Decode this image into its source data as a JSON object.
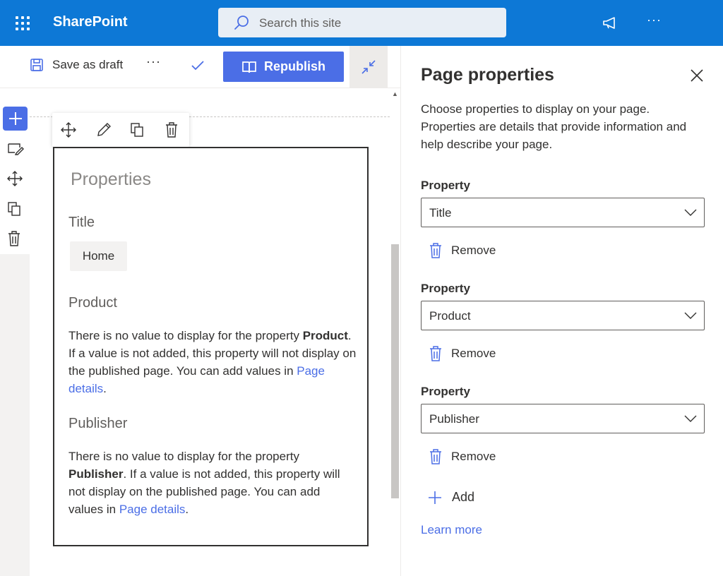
{
  "suite": {
    "brand": "SharePoint",
    "search_placeholder": "Search this site",
    "more": "···"
  },
  "command_bar": {
    "save_draft": "Save as draft",
    "more": "···",
    "republish": "Republish"
  },
  "webpart": {
    "title": "Properties",
    "fields": [
      {
        "label": "Title",
        "value": "Home"
      },
      {
        "label": "Product",
        "msg_prefix": "There is no value to display for the property ",
        "msg_bold": "Product",
        "msg_suffix": ". If a value is not added, this property will not display on the published page. You can add values in ",
        "link": "Page details",
        "msg_end": "."
      },
      {
        "label": "Publisher",
        "msg_prefix": "There is no value to display for the property ",
        "msg_bold": "Publisher",
        "msg_suffix": ". If a value is not added, this property will not display on the published page. You can add values in ",
        "link": "Page details",
        "msg_end": "."
      }
    ]
  },
  "panel": {
    "title": "Page properties",
    "description": "Choose properties to display on your page. Properties are details that provide information and help describe your page.",
    "properties": [
      {
        "label": "Property",
        "selected": "Title",
        "remove": "Remove"
      },
      {
        "label": "Property",
        "selected": "Product",
        "remove": "Remove"
      },
      {
        "label": "Property",
        "selected": "Publisher",
        "remove": "Remove"
      }
    ],
    "add": "Add",
    "learn_more": "Learn more"
  },
  "colors": {
    "suite_bar": "#0d78d6",
    "accent": "#4b6ee6"
  }
}
